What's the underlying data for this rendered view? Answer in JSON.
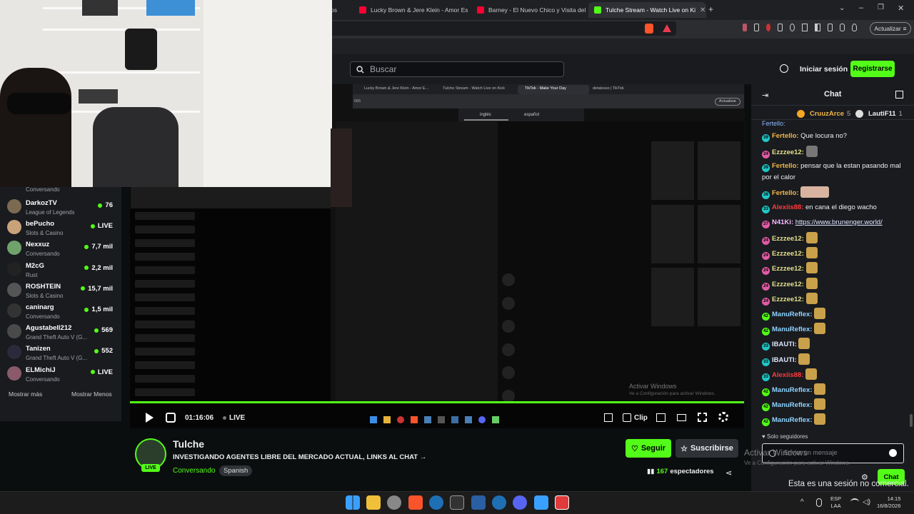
{
  "tabs": [
    {
      "label": "os",
      "color": "#888"
    },
    {
      "label": "Lucky Brown & Jere Klein - Amor Esc",
      "color": "#ff0033"
    },
    {
      "label": "Barney - El Nuevo Chico y Visita del",
      "color": "#ff0033"
    },
    {
      "label": "Tulche Stream - Watch Live on Ki",
      "color": "#53fc18"
    }
  ],
  "browser": {
    "update_label": "Actualizar"
  },
  "kick": {
    "search_placeholder": "Buscar",
    "login_label": "Iniciar sesión",
    "register_label": "Registrarse",
    "show_more": "Mostrar más",
    "show_less": "Mostrar Menos"
  },
  "sidebar": {
    "first_category": "Conversando",
    "channels": [
      {
        "name": "DarkozTV",
        "category": "League of Legends",
        "viewers": "76",
        "color": "#7a6a52"
      },
      {
        "name": "bePucho",
        "category": "Slots & Casino",
        "viewers": "LIVE",
        "color": "#c9a27a"
      },
      {
        "name": "Nexxuz",
        "category": "Conversando",
        "viewers": "7,7 mil",
        "color": "#6fa36b"
      },
      {
        "name": "M2cG",
        "category": "Rust",
        "viewers": "2,2 mil",
        "color": "#222222"
      },
      {
        "name": "ROSHTEIN",
        "category": "Slots & Casino",
        "viewers": "15,7 mil",
        "color": "#555555"
      },
      {
        "name": "caninarg",
        "category": "Conversando",
        "viewers": "1,5 mil",
        "color": "#333333"
      },
      {
        "name": "Agustabell212",
        "category": "Grand Theft Auto V (G...",
        "viewers": "569",
        "color": "#4a4a4a"
      },
      {
        "name": "Tanizen",
        "category": "Grand Theft Auto V (G...",
        "viewers": "552",
        "color": "#2a2a3a"
      },
      {
        "name": "ELMichiJ",
        "category": "Conversando",
        "viewers": "LIVE",
        "color": "#8a5a6a"
      }
    ]
  },
  "inner_browser": {
    "tabs": [
      "Lucky Brown & Jere Klein - Amor E...",
      "Tulche Stream - Watch Live on Kick",
      "TikTok - Make Your Day",
      "detalosso | TikTok"
    ],
    "url_fragment": "065",
    "update_label": "Actualizar",
    "lang_a": "inglés",
    "lang_b": "español"
  },
  "player": {
    "time": "01:16:06",
    "live_label": "LIVE",
    "clip_label": "Clip",
    "activate_title": "Activar Windows",
    "activate_sub": "Ve a Configuración para activar Windows."
  },
  "stream": {
    "streamer": "Tulche",
    "live_badge": "LIVE",
    "title": "INVESTIGANDO AGENTES LIBRE DEL MERCADO ACTUAL, LINKS AL CHAT →",
    "category": "Conversando",
    "language": "Spanish",
    "follow_label": "Seguir",
    "subscribe_label": "Suscribirse",
    "viewers": "167",
    "viewers_label": "espectadores"
  },
  "chat": {
    "header": "Chat",
    "pinned": [
      {
        "name": "CruuzArce",
        "count": "5"
      },
      {
        "name": "LautiF11",
        "count": "1"
      }
    ],
    "messages": [
      {
        "badge": "39",
        "badge_color": "#21c6c6",
        "user": "Fertello",
        "user_color": "#f2b84b",
        "text": "Que locura no?"
      },
      {
        "badge": "24",
        "badge_color": "#e05ba4",
        "user": "Ezzzee12",
        "user_color": "#e6e08a",
        "text": "",
        "emote": "#777777"
      },
      {
        "badge": "39",
        "badge_color": "#21c6c6",
        "user": "Fertello",
        "user_color": "#f2b84b",
        "text": "pensar que la estan pasando mal por el calor"
      },
      {
        "badge": "39",
        "badge_color": "#21c6c6",
        "user": "Fertello",
        "user_color": "#f2b84b",
        "text": "",
        "emote": "#d8b4a0",
        "wide": true
      },
      {
        "badge": "33",
        "badge_color": "#21c6c6",
        "user": "Alexiis88",
        "user_color": "#ff3b3b",
        "text": "en cana el diego wacho"
      },
      {
        "badge": "27",
        "badge_color": "#e05ba4",
        "user": "N41Ki",
        "user_color": "#f5b9ff",
        "text": "https://www.brunenger.world/",
        "link": true
      },
      {
        "badge": "24",
        "badge_color": "#e05ba4",
        "user": "Ezzzee12",
        "user_color": "#e6e08a",
        "text": "",
        "emote": "#c9a14a"
      },
      {
        "badge": "24",
        "badge_color": "#e05ba4",
        "user": "Ezzzee12",
        "user_color": "#e6e08a",
        "text": "",
        "emote": "#c9a14a"
      },
      {
        "badge": "24",
        "badge_color": "#e05ba4",
        "user": "Ezzzee12",
        "user_color": "#e6e08a",
        "text": "",
        "emote": "#c9a14a"
      },
      {
        "badge": "24",
        "badge_color": "#e05ba4",
        "user": "Ezzzee12",
        "user_color": "#e6e08a",
        "text": "",
        "emote": "#c9a14a"
      },
      {
        "badge": "24",
        "badge_color": "#e05ba4",
        "user": "Ezzzee12",
        "user_color": "#e6e08a",
        "text": "",
        "emote": "#c9a14a"
      },
      {
        "badge": "42",
        "badge_color": "#53fc18",
        "user": "ManuReflex",
        "user_color": "#8fd3ff",
        "text": "",
        "emote": "#c9a14a"
      },
      {
        "badge": "42",
        "badge_color": "#53fc18",
        "user": "ManuReflex",
        "user_color": "#8fd3ff",
        "text": "",
        "emote": "#c9a14a"
      },
      {
        "badge": "33",
        "badge_color": "#21c6c6",
        "user": "IBAUTI",
        "user_color": "#dfe6ff",
        "text": "",
        "emote": "#c9a14a"
      },
      {
        "badge": "33",
        "badge_color": "#21c6c6",
        "user": "IBAUTI",
        "user_color": "#dfe6ff",
        "text": "",
        "emote": "#c9a14a"
      },
      {
        "badge": "33",
        "badge_color": "#21c6c6",
        "user": "Alexiis88",
        "user_color": "#ff3b3b",
        "text": "",
        "emote": "#c9a14a"
      },
      {
        "badge": "42",
        "badge_color": "#53fc18",
        "user": "ManuReflex",
        "user_color": "#8fd3ff",
        "text": "",
        "emote": "#c9a14a"
      },
      {
        "badge": "42",
        "badge_color": "#53fc18",
        "user": "ManuReflex",
        "user_color": "#8fd3ff",
        "text": "",
        "emote": "#c9a14a"
      },
      {
        "badge": "42",
        "badge_color": "#53fc18",
        "user": "ManuReflex",
        "user_color": "#8fd3ff",
        "text": "",
        "emote": "#c9a14a"
      }
    ],
    "followers_only": "Solo seguidores",
    "input_placeholder": "Enviar un mensaje",
    "send_label": "Chat",
    "overlay_activate": "Activar Windows",
    "overlay_activate_sub": "Ve a Configuración para activar Windows.",
    "overlay_caption": "Esta es una sesión no comercial."
  },
  "taskbar": {
    "lang": "ESP",
    "layout": "LAA",
    "time": "14:15",
    "date": "16/8/2026"
  }
}
